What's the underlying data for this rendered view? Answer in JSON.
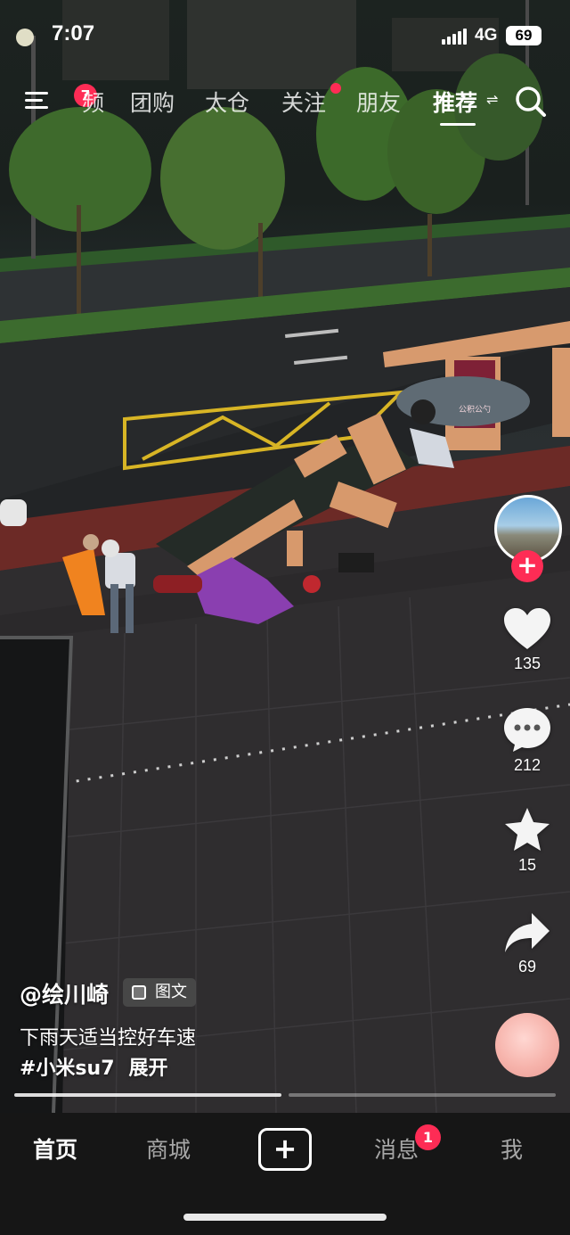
{
  "status_bar": {
    "time": "7:07",
    "network": "4G",
    "battery": "69"
  },
  "top_nav": {
    "menu_badge": "7",
    "tabs": [
      {
        "label": "频",
        "active": false
      },
      {
        "label": "团购",
        "active": false
      },
      {
        "label": "太仓",
        "active": false
      },
      {
        "label": "关注",
        "active": false,
        "dot": true
      },
      {
        "label": "朋友",
        "active": false
      },
      {
        "label": "推荐",
        "active": true
      }
    ],
    "more_glyph": "⇌"
  },
  "actions": {
    "likes": "135",
    "comments": "212",
    "favorites": "15",
    "shares": "69"
  },
  "post": {
    "author": "@绘川崎",
    "type_label": "图文",
    "caption": "下雨天适当控好车速",
    "hashtag": "#小米su7",
    "expand": "展开"
  },
  "photo_sign_text": "公积公勺",
  "bottom_nav": {
    "home": "首页",
    "mall": "商城",
    "create": "+",
    "messages": "消息",
    "messages_badge": "1",
    "me": "我"
  },
  "colors": {
    "accent": "#fe2c55",
    "nav_bg": "#161616"
  }
}
